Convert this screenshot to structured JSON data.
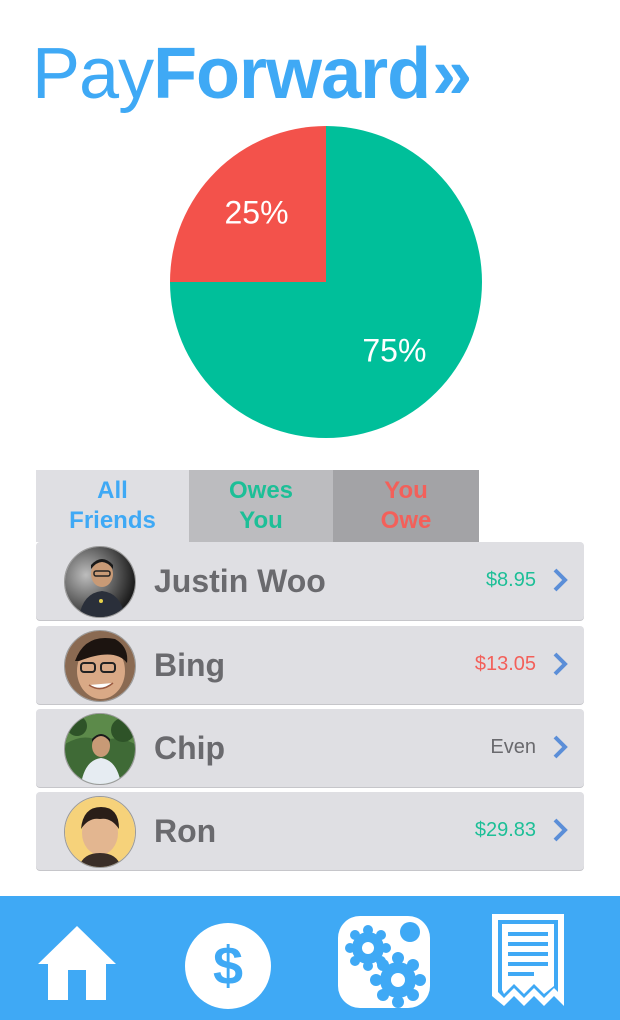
{
  "app": {
    "logo_part1": "Pay",
    "logo_part2": "Forward",
    "logo_arrows": "»",
    "brand_color": "#3fa9f5"
  },
  "chart_data": {
    "type": "pie",
    "slices": [
      {
        "label": "25%",
        "value": 25,
        "color": "#f3524b"
      },
      {
        "label": "75%",
        "value": 75,
        "color": "#00bf9a"
      }
    ]
  },
  "tabs": [
    {
      "label": "All\nFriends",
      "color": "#3fa9f5",
      "selected": true
    },
    {
      "label": "Owes\nYou",
      "color": "#1dbf97",
      "selected": false
    },
    {
      "label": "You\nOwe",
      "color": "#f3605a",
      "selected": false
    }
  ],
  "friends": [
    {
      "name": "Justin Woo",
      "amount": "$8.95",
      "status": "owes-you",
      "amount_color": "#1dbf97"
    },
    {
      "name": "Bing",
      "amount": "$13.05",
      "status": "you-owe",
      "amount_color": "#f3605a"
    },
    {
      "name": "Chip",
      "amount": "Even",
      "status": "even",
      "amount_color": "#6a6a6e"
    },
    {
      "name": "Ron",
      "amount": "$29.83",
      "status": "owes-you",
      "amount_color": "#1dbf97"
    }
  ],
  "tabbar": [
    {
      "icon": "home-icon"
    },
    {
      "icon": "dollar-icon"
    },
    {
      "icon": "gears-icon"
    },
    {
      "icon": "receipt-icon"
    }
  ]
}
